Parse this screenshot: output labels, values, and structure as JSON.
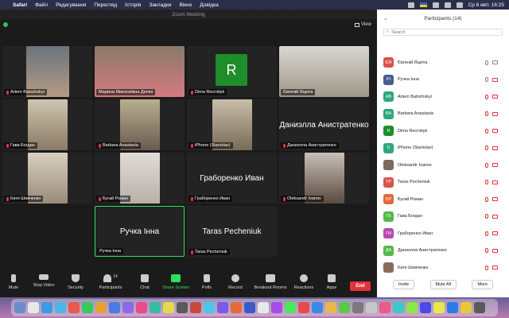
{
  "menubar": {
    "app": "Safari",
    "items": [
      "Файл",
      "Редагування",
      "Перегляд",
      "Історія",
      "Закладки",
      "Вікно",
      "Довідка"
    ],
    "datetime": "Ср 6 квіт.  16:25"
  },
  "window": {
    "title": "Zoom Meeting",
    "view_label": "View"
  },
  "tiles": [
    {
      "name": "Artem Batozhskyi"
    },
    {
      "name": "Марина Миколаївна Деліні"
    },
    {
      "name": "Dima Recrotiyk",
      "avatar": "R"
    },
    {
      "name": "Євгеній Яцюта"
    },
    {
      "name": "Гава Богдан"
    },
    {
      "name": "Barbara Anastasia"
    },
    {
      "name": "iPhone (Stanislav)"
    },
    {
      "name": "Даниэлла Анистратенко",
      "big": "Даниэлла Анистратенко"
    },
    {
      "name": "Катя Шевченко"
    },
    {
      "name": "Бугай Роман"
    },
    {
      "name": "Граборенко Иван",
      "big": "Граборенко Иван"
    },
    {
      "name": "Oleksandr Ivanov"
    },
    {
      "name": "Ручка Інна",
      "big": "Ручка Інна"
    },
    {
      "name": "Taras Pecheniuk",
      "big": "Taras Pecheniuk"
    }
  ],
  "toolbar": {
    "mute": "Mute",
    "stop_video": "Stop Video",
    "security": "Security",
    "participants": "Participants",
    "participants_count": "14",
    "chat": "Chat",
    "share_screen": "Share Screen",
    "polls": "Polls",
    "record": "Record",
    "breakout": "Breakout Rooms",
    "reactions": "Reactions",
    "apps": "Apps",
    "end": "End"
  },
  "panel": {
    "title": "Participants (14)",
    "search_placeholder": "Search",
    "participants": [
      {
        "initials": "ЄЯ",
        "name": "Євгеній Яцюта",
        "color": "#d9534f"
      },
      {
        "initials": "РІ",
        "name": "Ручка Інна",
        "color": "#4a5a8c"
      },
      {
        "initials": "AB",
        "name": "Artem Batozhskyi",
        "color": "#2ea87a"
      },
      {
        "initials": "BA",
        "name": "Barbara Anastasia",
        "color": "#2ea87a"
      },
      {
        "initials": "R",
        "name": "Dima Recrotiyk",
        "color": "#1e8d2a"
      },
      {
        "initials": "I(",
        "name": "iPhone (Stanislav)",
        "color": "#2ea87a"
      },
      {
        "initials": "",
        "name": "Oleksandr Ivanov",
        "color": "#7a6a5a"
      },
      {
        "initials": "TP",
        "name": "Taras Pecheniuk",
        "color": "#d9534f"
      },
      {
        "initials": "БР",
        "name": "Бугай Роман",
        "color": "#e06a3a"
      },
      {
        "initials": "ГБ",
        "name": "Гава Богдан",
        "color": "#52b84a"
      },
      {
        "initials": "ГИ",
        "name": "Граборенко Иван",
        "color": "#b64ab0"
      },
      {
        "initials": "ДА",
        "name": "Даниэлла Анистратенко",
        "color": "#52b84a"
      },
      {
        "initials": "",
        "name": "Катя Шевченко",
        "color": "#8a6a5a"
      }
    ],
    "invite": "Invite",
    "mute_all": "Mute All",
    "more": "More"
  }
}
